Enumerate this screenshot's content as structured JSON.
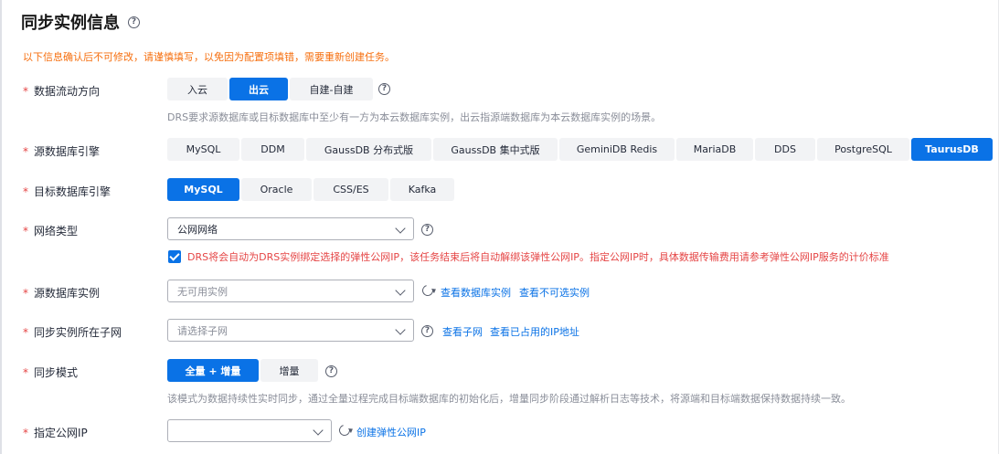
{
  "title": "同步实例信息",
  "warning": "以下信息确认后不可修改，请谨慎填写，以免因为配置项填错，需要重新创建任务。",
  "required_mark": "*",
  "help_glyph": "?",
  "flow_direction": {
    "label": "数据流动方向",
    "options": [
      "入云",
      "出云",
      "自建-自建"
    ],
    "selected": "出云",
    "hint": "DRS要求源数据库或目标数据库中至少有一方为本云数据库实例，出云指源端数据库为本云数据库实例的场景。"
  },
  "source_engine": {
    "label": "源数据库引擎",
    "options": [
      "MySQL",
      "DDM",
      "GaussDB 分布式版",
      "GaussDB 集中式版",
      "GeminiDB Redis",
      "MariaDB",
      "DDS",
      "PostgreSQL",
      "TaurusDB"
    ],
    "selected": "TaurusDB"
  },
  "target_engine": {
    "label": "目标数据库引擎",
    "options": [
      "MySQL",
      "Oracle",
      "CSS/ES",
      "Kafka"
    ],
    "selected": "MySQL"
  },
  "network_type": {
    "label": "网络类型",
    "value": "公网网络",
    "checkbox_checked": true,
    "checkbox_text": "DRS将会自动为DRS实例绑定选择的弹性公网IP，该任务结束后将自动解绑该弹性公网IP。指定公网IP时，具体数据传输费用请参考弹性公网IP服务的计价标准"
  },
  "source_instance": {
    "label": "源数据库实例",
    "placeholder": "无可用实例",
    "links": [
      "查看数据库实例",
      "查看不可选实例"
    ]
  },
  "subnet": {
    "label": "同步实例所在子网",
    "placeholder": "请选择子网",
    "links": [
      "查看子网",
      "查看已占用的IP地址"
    ]
  },
  "sync_mode": {
    "label": "同步模式",
    "options": [
      "全量 + 增量",
      "增量"
    ],
    "selected": "全量 + 增量",
    "hint": "该模式为数据持续性实时同步，通过全量过程完成目标端数据库的初始化后，增量同步阶段通过解析日志等技术，将源端和目标端数据保持数据持续一致。"
  },
  "public_ip": {
    "label": "指定公网IP",
    "value": "",
    "link": "创建弹性公网IP"
  },
  "colors": {
    "accent": "#0a72e6",
    "warning": "#f66f0f",
    "error": "#e54545"
  }
}
